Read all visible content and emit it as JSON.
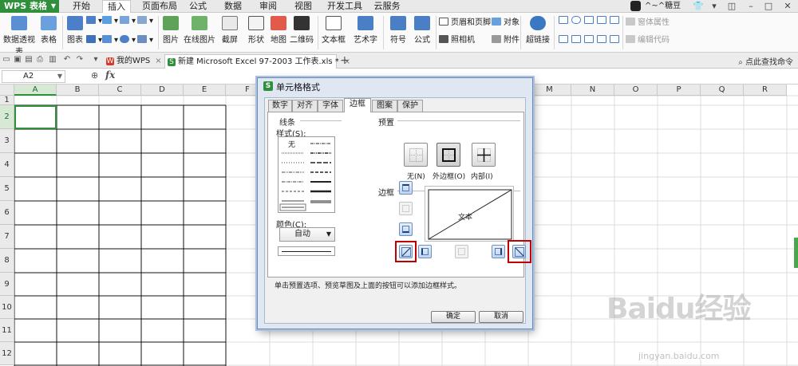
{
  "menubar": {
    "app": "WPS 表格",
    "tabs": [
      "开始",
      "插入",
      "页面布局",
      "公式",
      "数据",
      "审阅",
      "视图",
      "开发工具",
      "云服务"
    ],
    "active_tab": "插入",
    "user": "^~^糖豆",
    "theme_icon": "shirt-icon"
  },
  "ribbon": {
    "large": [
      "数据透视表",
      "表格",
      "图表",
      "图片",
      "在线图片",
      "截屏",
      "形状",
      "地图",
      "二维码",
      "文本框",
      "艺术字",
      "符号",
      "公式",
      "超链接"
    ],
    "small": [
      "页眉和页脚",
      "对象",
      "照相机",
      "附件"
    ],
    "disabled": [
      "窗体属性",
      "编辑代码"
    ]
  },
  "tabbar": {
    "tabs": [
      {
        "label": "我的WPS",
        "close": "×"
      },
      {
        "label": "新建 Microsoft Excel 97-2003 工作表.xls *",
        "close": "×"
      }
    ],
    "plus": "+",
    "find": "点此查找命令"
  },
  "formula": {
    "cell": "A2",
    "fx": "fx"
  },
  "sheet": {
    "columns": [
      "A",
      "B",
      "C",
      "D",
      "E",
      "F",
      "G",
      "H",
      "I",
      "J",
      "K",
      "L",
      "M",
      "N",
      "O",
      "P",
      "Q",
      "R"
    ],
    "rows": [
      "1",
      "2",
      "3",
      "4",
      "5",
      "6",
      "7",
      "8",
      "9",
      "10",
      "11",
      "12"
    ],
    "selected_col": "A",
    "selected_row": "2"
  },
  "dialog": {
    "title": "单元格格式",
    "tabs": [
      "数字",
      "对齐",
      "字体",
      "边框",
      "图案",
      "保护"
    ],
    "active_tab": "边框",
    "line_group": "线条",
    "style_label": "样式(S):",
    "none_style": "无",
    "color_label": "颜色(C):",
    "color_value": "自动",
    "preset_group": "预置",
    "presets": [
      "无(N)",
      "外边框(O)",
      "内部(I)"
    ],
    "border_group": "边框",
    "preview_text": "文本",
    "hint": "单击预置选项、预览草图及上面的按钮可以添加边框样式。",
    "ok": "确定",
    "cancel": "取消"
  },
  "watermark": {
    "brand": "Baidu经验",
    "url": "jingyan.baidu.com"
  }
}
